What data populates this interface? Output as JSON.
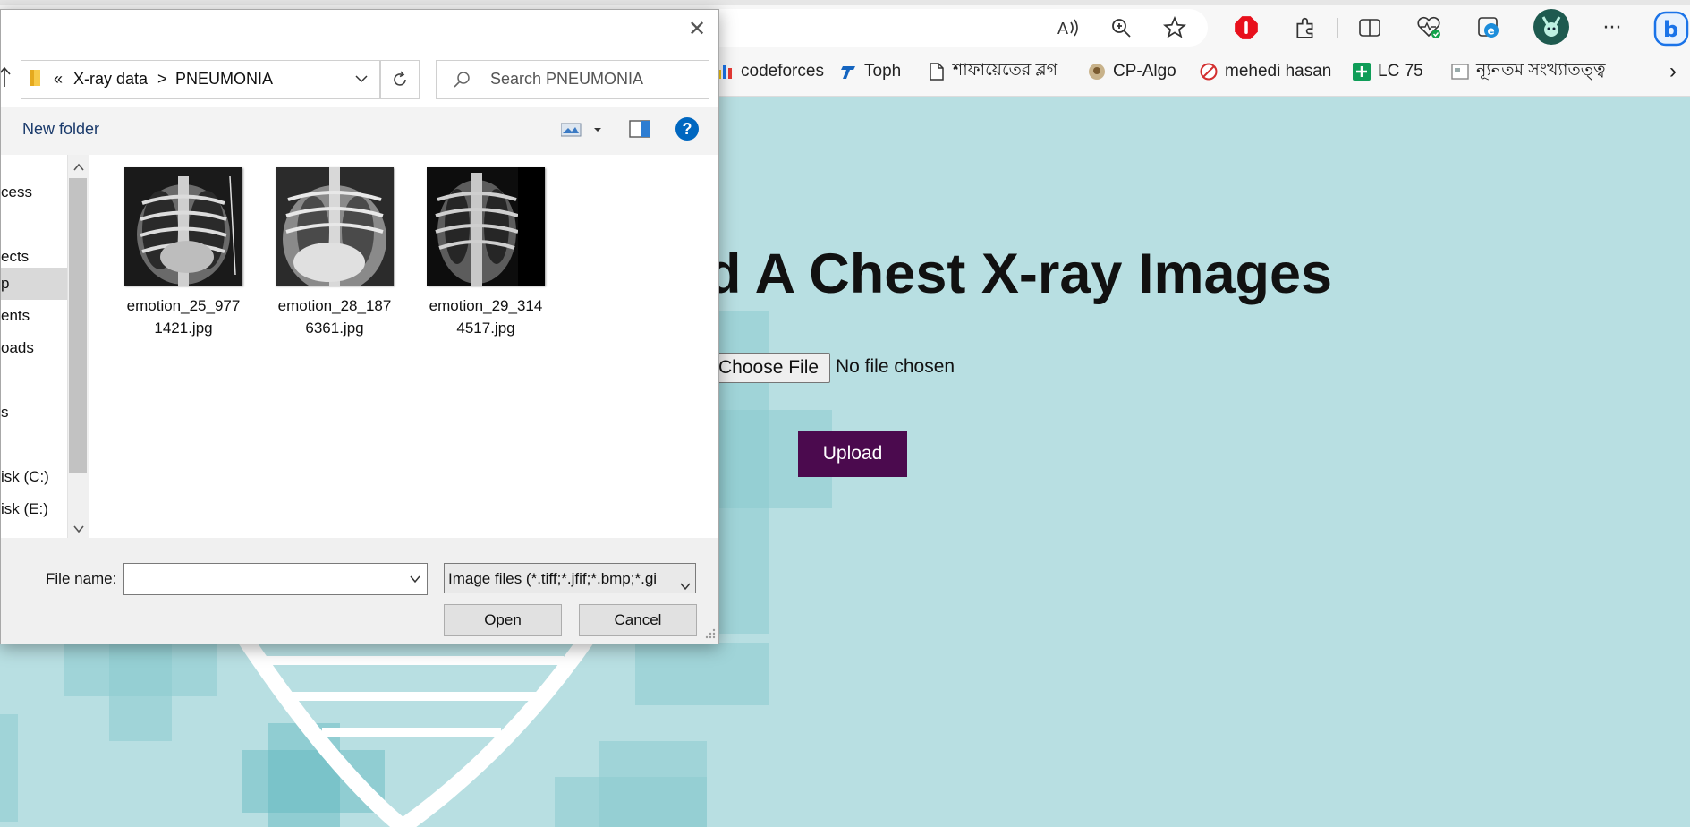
{
  "browser": {
    "toolbar_icons": [
      "read-aloud-icon",
      "zoom-icon",
      "favorite-star-icon",
      "adblock-icon",
      "extensions-icon",
      "split-screen-icon",
      "browser-essentials-icon",
      "collections-icon",
      "profile-avatar",
      "more-icon",
      "copilot-icon"
    ],
    "more_glyph": "···",
    "bookmarks": [
      {
        "label": "codeforces",
        "icon": "codeforces-icon"
      },
      {
        "label": "Toph",
        "icon": "toph-icon"
      },
      {
        "label": "শাফায়েতের ব্লগ",
        "icon": "document-icon"
      },
      {
        "label": "CP-Algo",
        "icon": "cp-algo-icon"
      },
      {
        "label": "mehedi hasan",
        "icon": "stop-icon"
      },
      {
        "label": "LC 75",
        "icon": "plus-square-icon"
      },
      {
        "label": "ন্যূনতম সংখ্যাতত্ত্ব",
        "icon": "page-icon"
      }
    ],
    "overflow_glyph": "›"
  },
  "page": {
    "title": "d A Chest X-ray Images",
    "choose_file_label": "Choose File",
    "no_file_text": "No file chosen",
    "upload_label": "Upload"
  },
  "dialog": {
    "close_glyph": "✕",
    "breadcrumb": {
      "overflow": "«",
      "folder1": "X-ray data",
      "separator": ">",
      "folder2": "PNEUMONIA"
    },
    "search_placeholder": "Search PNEUMONIA",
    "new_folder_label": "New folder",
    "help_glyph": "?",
    "nav_items": [
      "cess",
      "ects",
      "p",
      "ents",
      "oads",
      "s",
      "isk (C:)",
      "isk (E:)"
    ],
    "files": [
      {
        "name": "emotion_25_977\n1421.jpg"
      },
      {
        "name": "emotion_28_187\n6361.jpg"
      },
      {
        "name": "emotion_29_314\n4517.jpg"
      }
    ],
    "file_name_label": "File name:",
    "file_name_value": "",
    "file_type_value": "Image files (*.tiff;*.jfif;*.bmp;*.gi",
    "open_label": "Open",
    "cancel_label": "Cancel"
  },
  "colors": {
    "page_bg": "#b8dfe2",
    "upload_bg": "#4b0a4e",
    "help_blue": "#0067c0"
  }
}
